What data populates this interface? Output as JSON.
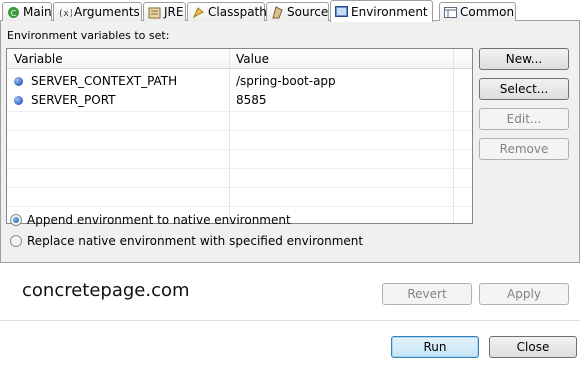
{
  "tabs": [
    {
      "label": "Main",
      "icon": "main-icon"
    },
    {
      "label": "Arguments",
      "icon": "arguments-icon"
    },
    {
      "label": "JRE",
      "icon": "jre-icon"
    },
    {
      "label": "Classpath",
      "icon": "classpath-icon"
    },
    {
      "label": "Source",
      "icon": "source-icon"
    },
    {
      "label": "Environment",
      "icon": "environment-icon",
      "active": true
    },
    {
      "label": "Common",
      "icon": "common-icon"
    }
  ],
  "env": {
    "label": "Environment variables to set:",
    "columns": [
      "Variable",
      "Value"
    ],
    "rows": [
      {
        "variable": "SERVER_CONTEXT_PATH",
        "value": "/spring-boot-app"
      },
      {
        "variable": "SERVER_PORT",
        "value": "8585"
      }
    ]
  },
  "side_buttons": {
    "new": "New...",
    "select": "Select...",
    "edit": "Edit...",
    "remove": "Remove"
  },
  "options": {
    "append": "Append environment to native environment",
    "replace": "Replace native environment with specified environment",
    "selected": "append"
  },
  "watermark": "concretepage.com",
  "actions": {
    "revert": "Revert",
    "apply": "Apply",
    "run": "Run",
    "close": "Close"
  }
}
